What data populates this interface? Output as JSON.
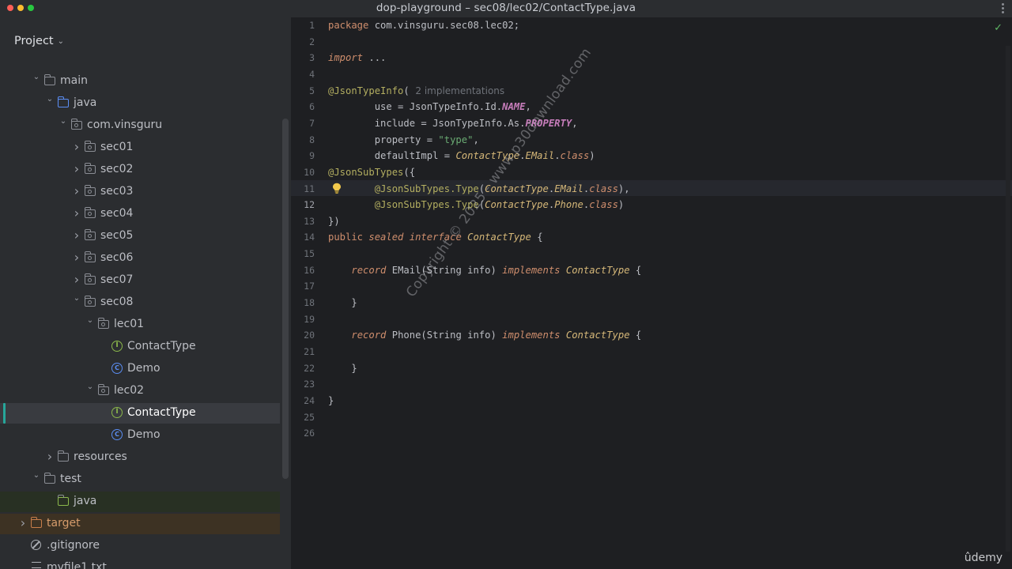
{
  "window": {
    "title": "dop-playground – sec08/lec02/ContactType.java"
  },
  "sidebar": {
    "header": "Project",
    "tree": [
      {
        "label": "main",
        "indent": 2,
        "arrow": "down",
        "icon": "folder"
      },
      {
        "label": "java",
        "indent": 3,
        "arrow": "down",
        "icon": "source-folder"
      },
      {
        "label": "com.vinsguru",
        "indent": 4,
        "arrow": "down",
        "icon": "package"
      },
      {
        "label": "sec01",
        "indent": 5,
        "arrow": "right",
        "icon": "package"
      },
      {
        "label": "sec02",
        "indent": 5,
        "arrow": "right",
        "icon": "package"
      },
      {
        "label": "sec03",
        "indent": 5,
        "arrow": "right",
        "icon": "package"
      },
      {
        "label": "sec04",
        "indent": 5,
        "arrow": "right",
        "icon": "package"
      },
      {
        "label": "sec05",
        "indent": 5,
        "arrow": "right",
        "icon": "package"
      },
      {
        "label": "sec06",
        "indent": 5,
        "arrow": "right",
        "icon": "package"
      },
      {
        "label": "sec07",
        "indent": 5,
        "arrow": "right",
        "icon": "package"
      },
      {
        "label": "sec08",
        "indent": 5,
        "arrow": "down",
        "icon": "package"
      },
      {
        "label": "lec01",
        "indent": 6,
        "arrow": "down",
        "icon": "package"
      },
      {
        "label": "ContactType",
        "indent": 7,
        "arrow": "",
        "icon": "interface"
      },
      {
        "label": "Demo",
        "indent": 7,
        "arrow": "",
        "icon": "class"
      },
      {
        "label": "lec02",
        "indent": 6,
        "arrow": "down",
        "icon": "package"
      },
      {
        "label": "ContactType",
        "indent": 7,
        "arrow": "",
        "icon": "interface",
        "selected": true
      },
      {
        "label": "Demo",
        "indent": 7,
        "arrow": "",
        "icon": "class"
      },
      {
        "label": "resources",
        "indent": 3,
        "arrow": "right",
        "icon": "resources-folder"
      },
      {
        "label": "test",
        "indent": 2,
        "arrow": "down",
        "icon": "folder"
      },
      {
        "label": "java",
        "indent": 3,
        "arrow": "",
        "icon": "test-folder",
        "highlight": "green"
      },
      {
        "label": "target",
        "indent": 1,
        "arrow": "right",
        "icon": "excluded-folder",
        "highlight": "orange"
      },
      {
        "label": ".gitignore",
        "indent": 1,
        "arrow": "",
        "icon": "ignore"
      },
      {
        "label": "myfile1.txt",
        "indent": 1,
        "arrow": "",
        "icon": "text-file"
      }
    ]
  },
  "editor": {
    "line_numbers": [
      "1",
      "2",
      "3",
      "4",
      "5",
      "6",
      "7",
      "8",
      "9",
      "10",
      "11",
      "12",
      "13",
      "14",
      "15",
      "16",
      "17",
      "18",
      "19",
      "20",
      "21",
      "22",
      "23",
      "24",
      "25",
      "26"
    ],
    "current_line": "12",
    "lines": [
      [
        {
          "t": "package",
          "c": "kwp"
        },
        {
          "t": " com.vinsguru.sec08.lec02;",
          "c": ""
        }
      ],
      [],
      [
        {
          "t": "import",
          "c": "kw"
        },
        {
          "t": " ...",
          "c": ""
        }
      ],
      [],
      [
        {
          "t": "@JsonTypeInfo",
          "c": "ann"
        },
        {
          "t": "(",
          "c": ""
        },
        {
          "t": "  2 implementations",
          "c": "hint"
        }
      ],
      [
        {
          "t": "        use = JsonTypeInfo.Id.",
          "c": ""
        },
        {
          "t": "NAME",
          "c": "fld"
        },
        {
          "t": ",",
          "c": ""
        }
      ],
      [
        {
          "t": "        include = JsonTypeInfo.As.",
          "c": ""
        },
        {
          "t": "PROPERTY",
          "c": "fld"
        },
        {
          "t": ",",
          "c": ""
        }
      ],
      [
        {
          "t": "        property = ",
          "c": ""
        },
        {
          "t": "\"type\"",
          "c": "str"
        },
        {
          "t": ",",
          "c": ""
        }
      ],
      [
        {
          "t": "        defaultImpl = ",
          "c": ""
        },
        {
          "t": "ContactType",
          "c": "cls"
        },
        {
          "t": ".",
          "c": ""
        },
        {
          "t": "EMail",
          "c": "cls"
        },
        {
          "t": ".",
          "c": ""
        },
        {
          "t": "class",
          "c": "kw"
        },
        {
          "t": ")",
          "c": ""
        }
      ],
      [
        {
          "t": "@JsonSubTypes",
          "c": "ann"
        },
        {
          "t": "({",
          "c": ""
        }
      ],
      [
        {
          "t": "        @JsonSubTypes.Type",
          "c": "ann"
        },
        {
          "t": "(",
          "c": ""
        },
        {
          "t": "ContactType",
          "c": "cls"
        },
        {
          "t": ".",
          "c": ""
        },
        {
          "t": "EMail",
          "c": "cls"
        },
        {
          "t": ".",
          "c": ""
        },
        {
          "t": "class",
          "c": "kw"
        },
        {
          "t": "),",
          "c": ""
        }
      ],
      [
        {
          "t": "        @JsonSubTypes.Type",
          "c": "ann"
        },
        {
          "t": "(",
          "c": ""
        },
        {
          "t": "ContactType",
          "c": "cls"
        },
        {
          "t": ".",
          "c": ""
        },
        {
          "t": "Phone",
          "c": "cls"
        },
        {
          "t": ".",
          "c": ""
        },
        {
          "t": "class",
          "c": "kw"
        },
        {
          "t": ")",
          "c": ""
        }
      ],
      [
        {
          "t": "})",
          "c": ""
        }
      ],
      [
        {
          "t": "public",
          "c": "kwp"
        },
        {
          "t": " ",
          "c": ""
        },
        {
          "t": "sealed",
          "c": "kw"
        },
        {
          "t": " ",
          "c": ""
        },
        {
          "t": "interface",
          "c": "kw"
        },
        {
          "t": " ",
          "c": ""
        },
        {
          "t": "ContactType",
          "c": "cls"
        },
        {
          "t": " {",
          "c": ""
        }
      ],
      [],
      [
        {
          "t": "    ",
          "c": ""
        },
        {
          "t": "record",
          "c": "kw"
        },
        {
          "t": " EMail(String info) ",
          "c": ""
        },
        {
          "t": "implements",
          "c": "kw"
        },
        {
          "t": " ",
          "c": ""
        },
        {
          "t": "ContactType",
          "c": "cls"
        },
        {
          "t": " {",
          "c": ""
        }
      ],
      [],
      [
        {
          "t": "    }",
          "c": ""
        }
      ],
      [],
      [
        {
          "t": "    ",
          "c": ""
        },
        {
          "t": "record",
          "c": "kw"
        },
        {
          "t": " Phone(String info) ",
          "c": ""
        },
        {
          "t": "implements",
          "c": "kw"
        },
        {
          "t": " ",
          "c": ""
        },
        {
          "t": "ContactType",
          "c": "cls"
        },
        {
          "t": " {",
          "c": ""
        }
      ],
      [],
      [
        {
          "t": "    }",
          "c": ""
        }
      ],
      [],
      [
        {
          "t": "}",
          "c": ""
        }
      ],
      []
    ]
  },
  "watermark": "Copyright © 2025 - www.p30download.com",
  "brand": "ûdemy",
  "colors": {
    "selection_marker": "#26a69a",
    "annotation": "#b3ae60",
    "keyword": "#cf8e6d",
    "string": "#6aab73"
  }
}
